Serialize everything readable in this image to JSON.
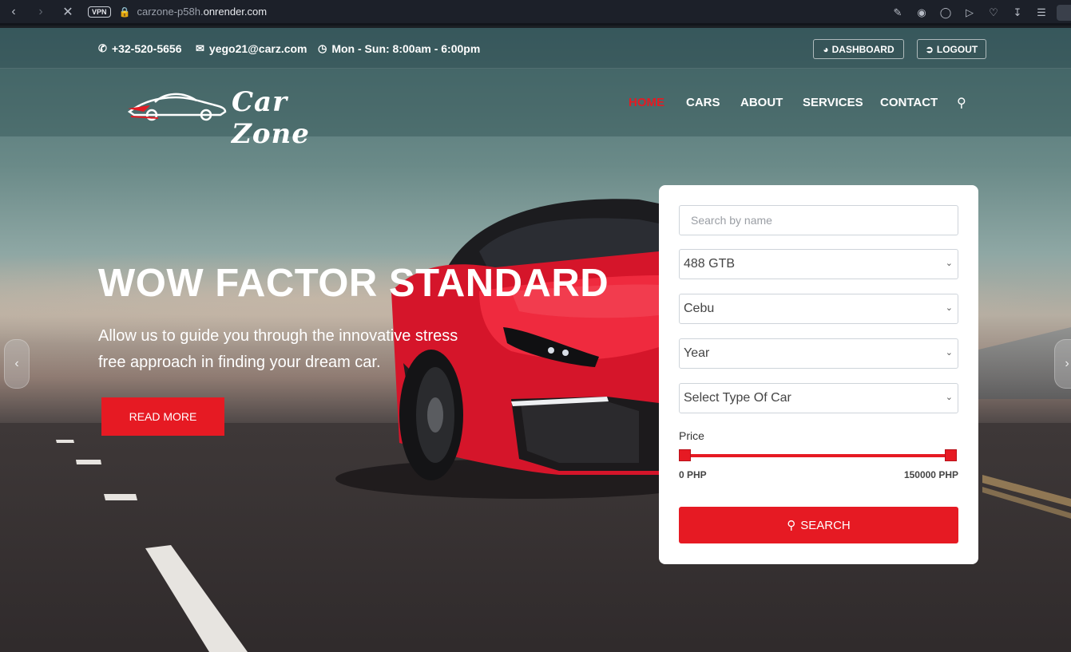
{
  "browser": {
    "vpn_label": "VPN",
    "url_subdomain": "carzone-p58h.",
    "url_domain": "onrender.com"
  },
  "topbar": {
    "phone": "+32-520-5656",
    "email": "yego21@carz.com",
    "hours": "Mon - Sun: 8:00am - 6:00pm",
    "dashboard_label": "DASHBOARD",
    "logout_label": "LOGOUT"
  },
  "brand": {
    "logo_text": "Car Zone"
  },
  "nav": {
    "items": [
      {
        "label": "HOME",
        "active": true
      },
      {
        "label": "CARS"
      },
      {
        "label": "ABOUT"
      },
      {
        "label": "SERVICES"
      },
      {
        "label": "CONTACT"
      }
    ]
  },
  "hero": {
    "headline": "WOW FACTOR STANDARD",
    "subtitle": "Allow us to guide you through the innovative stress free approach in finding your dream car.",
    "cta_label": "READ MORE"
  },
  "search_form": {
    "name_placeholder": "Search by name",
    "model_value": "488 GTB",
    "location_value": "Cebu",
    "year_value": "Year",
    "type_value": "Select Type Of Car",
    "price_label": "Price",
    "price_min": "0 PHP",
    "price_max": "150000 PHP",
    "price_range_fraction": [
      0,
      1
    ],
    "submit_label": "SEARCH"
  },
  "colors": {
    "accent": "#e61a23",
    "nav_active": "#e31b23"
  }
}
